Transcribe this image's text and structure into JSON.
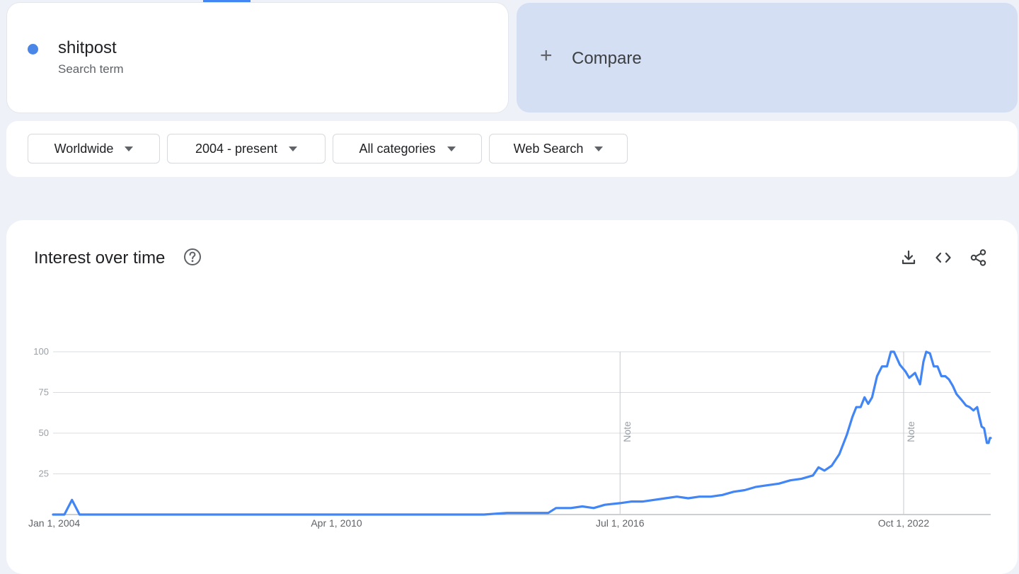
{
  "search_term": {
    "name": "shitpost",
    "subtitle": "Search term",
    "color": "#4a86e8"
  },
  "compare": {
    "icon": "plus-icon",
    "label": "Compare"
  },
  "filters": [
    {
      "label": "Worldwide"
    },
    {
      "label": "2004 - present"
    },
    {
      "label": "All categories"
    },
    {
      "label": "Web Search"
    }
  ],
  "interest_over_time": {
    "title": "Interest over time",
    "help_icon": "help-circle-icon",
    "actions": [
      "download-icon",
      "embed-code-icon",
      "share-icon"
    ],
    "note_label": "Note"
  },
  "chart_data": {
    "type": "line",
    "title": "Interest over time",
    "xlabel": "",
    "ylabel": "",
    "ylim": [
      0,
      100
    ],
    "y_ticks": [
      25,
      50,
      75,
      100
    ],
    "x_ticks": [
      "Jan 1, 2004",
      "Apr 1, 2010",
      "Jul 1, 2016",
      "Oct 1, 2022"
    ],
    "x_range": [
      "2004-01-01",
      "2024-09-01"
    ],
    "grid": true,
    "annotations": [
      {
        "x": "2016-07-01",
        "label": "Note"
      },
      {
        "x": "2022-10-01",
        "label": "Note"
      }
    ],
    "series": [
      {
        "color": "#4285f4",
        "points": [
          [
            "2004-01-01",
            0
          ],
          [
            "2004-04-01",
            0
          ],
          [
            "2004-06-01",
            9
          ],
          [
            "2004-08-01",
            0
          ],
          [
            "2006-01-01",
            0
          ],
          [
            "2008-01-01",
            0
          ],
          [
            "2010-01-01",
            0
          ],
          [
            "2012-01-01",
            0
          ],
          [
            "2013-07-01",
            0
          ],
          [
            "2014-01-01",
            1
          ],
          [
            "2014-04-01",
            1
          ],
          [
            "2014-09-01",
            1
          ],
          [
            "2014-12-01",
            1
          ],
          [
            "2015-02-01",
            4
          ],
          [
            "2015-06-01",
            4
          ],
          [
            "2015-09-01",
            5
          ],
          [
            "2015-12-01",
            4
          ],
          [
            "2016-03-01",
            6
          ],
          [
            "2016-07-01",
            7
          ],
          [
            "2016-10-01",
            8
          ],
          [
            "2017-01-01",
            8
          ],
          [
            "2017-04-01",
            9
          ],
          [
            "2017-07-01",
            10
          ],
          [
            "2017-10-01",
            11
          ],
          [
            "2018-01-01",
            10
          ],
          [
            "2018-04-01",
            11
          ],
          [
            "2018-07-01",
            11
          ],
          [
            "2018-10-01",
            12
          ],
          [
            "2019-01-01",
            14
          ],
          [
            "2019-04-01",
            15
          ],
          [
            "2019-07-01",
            17
          ],
          [
            "2019-10-01",
            18
          ],
          [
            "2020-01-01",
            19
          ],
          [
            "2020-04-01",
            21
          ],
          [
            "2020-07-01",
            22
          ],
          [
            "2020-10-01",
            24
          ],
          [
            "2020-11-15",
            29
          ],
          [
            "2021-01-01",
            27
          ],
          [
            "2021-03-01",
            30
          ],
          [
            "2021-05-01",
            37
          ],
          [
            "2021-07-01",
            49
          ],
          [
            "2021-08-15",
            60
          ],
          [
            "2021-09-15",
            66
          ],
          [
            "2021-10-20",
            66
          ],
          [
            "2021-11-20",
            72
          ],
          [
            "2021-12-20",
            68
          ],
          [
            "2022-01-20",
            72
          ],
          [
            "2022-03-01",
            85
          ],
          [
            "2022-04-10",
            91
          ],
          [
            "2022-05-20",
            91
          ],
          [
            "2022-06-20",
            100
          ],
          [
            "2022-07-15",
            100
          ],
          [
            "2022-09-01",
            92
          ],
          [
            "2022-10-15",
            88
          ],
          [
            "2022-11-15",
            84
          ],
          [
            "2023-01-01",
            87
          ],
          [
            "2023-02-10",
            80
          ],
          [
            "2023-03-10",
            94
          ],
          [
            "2023-04-01",
            100
          ],
          [
            "2023-05-01",
            99
          ],
          [
            "2023-06-01",
            91
          ],
          [
            "2023-07-01",
            91
          ],
          [
            "2023-08-01",
            85
          ],
          [
            "2023-09-01",
            85
          ],
          [
            "2023-10-01",
            83
          ],
          [
            "2023-11-01",
            79
          ],
          [
            "2023-12-01",
            74
          ],
          [
            "2024-01-15",
            70
          ],
          [
            "2024-02-15",
            67
          ],
          [
            "2024-03-15",
            66
          ],
          [
            "2024-04-15",
            64
          ],
          [
            "2024-05-15",
            66
          ],
          [
            "2024-06-01",
            60
          ],
          [
            "2024-06-20",
            54
          ],
          [
            "2024-07-10",
            53
          ],
          [
            "2024-08-01",
            44
          ],
          [
            "2024-08-15",
            44
          ],
          [
            "2024-08-25",
            47
          ],
          [
            "2024-09-01",
            47
          ]
        ]
      }
    ]
  }
}
